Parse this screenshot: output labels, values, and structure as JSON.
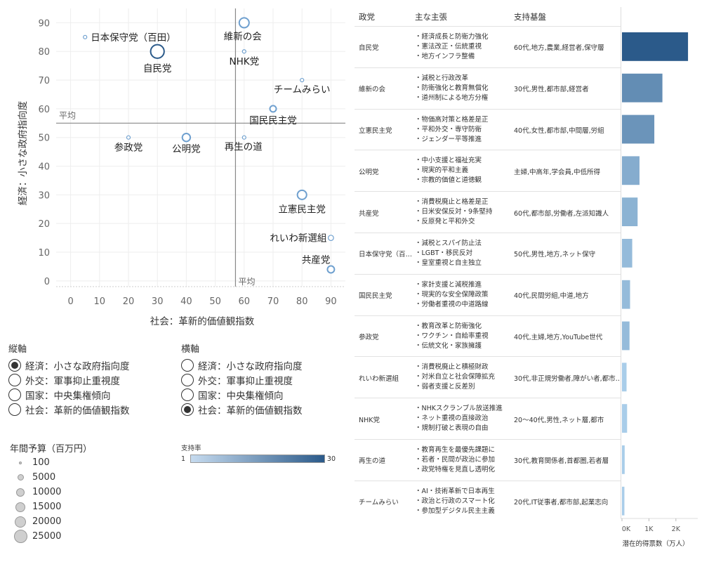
{
  "chart_data": {
    "type": "scatter",
    "xlabel": "社会：革新的価値観指数",
    "ylabel": "経済：小さな政府指向度",
    "xlim": [
      -5,
      95
    ],
    "ylim": [
      -2,
      95
    ],
    "x_ticks": [
      0,
      10,
      20,
      30,
      40,
      50,
      60,
      70,
      80,
      90
    ],
    "y_ticks": [
      0,
      10,
      20,
      30,
      40,
      50,
      60,
      70,
      80,
      90
    ],
    "avg_label_x": "平均",
    "avg_label_y": "平均",
    "avg_x": 57,
    "avg_y": 55,
    "points": [
      {
        "label": "日本保守党（百田）",
        "x": 5,
        "y": 85,
        "budget": 100
      },
      {
        "label": "維新の会",
        "x": 60,
        "y": 90,
        "budget": 10000
      },
      {
        "label": "自民党",
        "x": 30,
        "y": 80,
        "budget": 25000
      },
      {
        "label": "NHK党",
        "x": 60,
        "y": 80,
        "budget": 100
      },
      {
        "label": "チームみらい",
        "x": 80,
        "y": 70,
        "budget": 100
      },
      {
        "label": "国民民主党",
        "x": 70,
        "y": 60,
        "budget": 2000
      },
      {
        "label": "参政党",
        "x": 20,
        "y": 50,
        "budget": 100
      },
      {
        "label": "公明党",
        "x": 40,
        "y": 50,
        "budget": 5000
      },
      {
        "label": "再生の道",
        "x": 60,
        "y": 50,
        "budget": 100
      },
      {
        "label": "立憲民主党",
        "x": 80,
        "y": 30,
        "budget": 8000
      },
      {
        "label": "れいわ新選組",
        "x": 90,
        "y": 15,
        "budget": 800
      },
      {
        "label": "共産党",
        "x": 90,
        "y": 4,
        "budget": 3000
      }
    ]
  },
  "bar_chart": {
    "type": "bar",
    "xlabel": "潜在的得票数（万人）",
    "x_ticks": [
      "0K",
      "1K",
      "2K"
    ],
    "x_tick_values": [
      0,
      1000,
      2000
    ],
    "xlim": [
      0,
      2500
    ],
    "categories": [
      "自民党",
      "維新の会",
      "立憲民主党",
      "公明党",
      "共産党",
      "日本保守党（百…",
      "国民民主党",
      "参政党",
      "れいわ新選組",
      "NHK党",
      "再生の道",
      "チームみらい"
    ],
    "values": [
      2450,
      1500,
      1200,
      650,
      580,
      380,
      300,
      280,
      170,
      190,
      100,
      90
    ],
    "support_rate": [
      30,
      11,
      9,
      4,
      3,
      2,
      2,
      2,
      1,
      1,
      1,
      1
    ]
  },
  "table": {
    "headers": [
      "政党",
      "主な主張",
      "支持基盤"
    ],
    "rows": [
      {
        "party": "自民党",
        "policies": [
          "・経済成長と防衛力強化",
          "・憲法改正・伝統重視",
          "・地方インフラ整備"
        ],
        "base": "60代,地方,農業,経営者,保守層"
      },
      {
        "party": "維新の会",
        "policies": [
          "・減税と行政改革",
          "・防衛強化と教育無償化",
          "・道州制による地方分権"
        ],
        "base": "30代,男性,都市部,経営者"
      },
      {
        "party": "立憲民主党",
        "policies": [
          "・物価高対策と格差是正",
          "・平和外交・専守防衛",
          "・ジェンダー平等推進"
        ],
        "base": "40代,女性,都市部,中間層,労組"
      },
      {
        "party": "公明党",
        "policies": [
          "・中小支援と福祉充実",
          "・現実的平和主義",
          "・宗教的価値と道徳観"
        ],
        "base": "主婦,中高年,学会員,中低所得"
      },
      {
        "party": "共産党",
        "policies": [
          "・消費税廃止と格差是正",
          "・日米安保反対・9条堅持",
          "・反原発と平和外交"
        ],
        "base": "60代,都市部,労働者,左派知識人"
      },
      {
        "party": "日本保守党（百…",
        "policies": [
          "・減税とスパイ防止法",
          "・LGBT・移民反対",
          "・皇室重視と自主独立"
        ],
        "base": "50代,男性,地方,ネット保守"
      },
      {
        "party": "国民民主党",
        "policies": [
          "・家計支援と減税推進",
          "・現実的な安全保障政策",
          "・労働者重視の中道路線"
        ],
        "base": "40代,民間労組,中道,地方"
      },
      {
        "party": "参政党",
        "policies": [
          "・教育改革と防衛強化",
          "・ワクチン・自給率重視",
          "・伝統文化・家族擁護"
        ],
        "base": "40代,主婦,地方,YouTube世代"
      },
      {
        "party": "れいわ新選組",
        "policies": [
          "・消費税廃止と積極財政",
          "・対米自立と社会保障拡充",
          "・弱者支援と反差別"
        ],
        "base": "30代,非正規労働者,障がい者,都市…"
      },
      {
        "party": "NHK党",
        "policies": [
          "・NHKスクランブル放送推進",
          "・ネット重視の直接政治",
          "・規制打破と表現の自由"
        ],
        "base": "20～40代,男性,ネット層,都市"
      },
      {
        "party": "再生の道",
        "policies": [
          "・教育再生を最優先課題に",
          "・若者・民間が政治に参加",
          "・政党特権を見直し透明化"
        ],
        "base": "30代,教育関係者,首都圏,若者層"
      },
      {
        "party": "チームみらい",
        "policies": [
          "・AI・技術革新で日本再生",
          "・政治と行政のスマート化",
          "・参加型デジタル民主主義"
        ],
        "base": "20代,IT従事者,都市部,起業志向"
      }
    ]
  },
  "legend_vertical": {
    "title": "縦軸",
    "options": [
      "経済：小さな政府指向度",
      "外交：軍事抑止重視度",
      "国家：中央集権傾向",
      "社会：革新的価値観指数"
    ],
    "selected": 0
  },
  "legend_horizontal": {
    "title": "横軸",
    "options": [
      "経済：小さな政府指向度",
      "外交：軍事抑止重視度",
      "国家：中央集権傾向",
      "社会：革新的価値観指数"
    ],
    "selected": 3
  },
  "legend_size": {
    "title": "年間予算（百万円）",
    "values": [
      "100",
      "5000",
      "10000",
      "15000",
      "20000",
      "25000"
    ]
  },
  "legend_color": {
    "title": "支持率",
    "min": "1",
    "max": "30",
    "color_low": "#c6dbef",
    "color_high": "#2b5a8a"
  },
  "colors": {
    "point_stroke": "#6fa0cf",
    "point_stroke_big": "#2b5a8a",
    "bar_dark": "#2b5a8a",
    "bar_light": "#a9cde9"
  }
}
